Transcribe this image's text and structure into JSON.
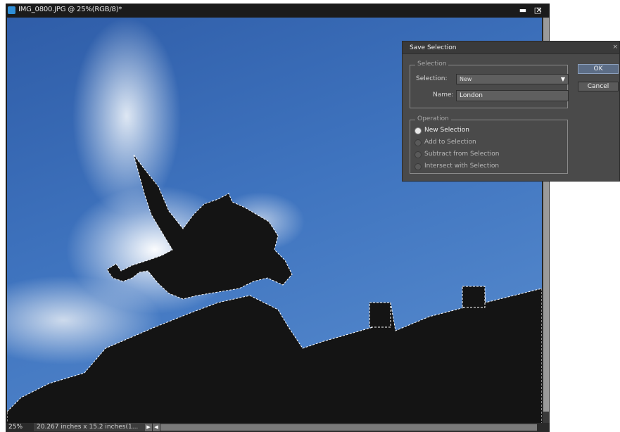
{
  "window": {
    "title": "IMG_0800.JPG @ 25%(RGB/8)*",
    "minimize_glyph": "▬",
    "maximize_glyph": "□",
    "close_glyph": "✕"
  },
  "status": {
    "zoom": "25%",
    "doc_size": "20.267 inches x 15.2 inches(1...",
    "scroll_right_glyph": "▶",
    "scroll_left_glyph": "◀"
  },
  "dialog": {
    "title": "Save Selection",
    "close_glyph": "×",
    "selection_group": "Selection",
    "selection_label": "Selection:",
    "selection_value": "New",
    "selection_arrow": "▼",
    "name_label": "Name:",
    "name_value": "London",
    "operation_group": "Operation",
    "operations": [
      {
        "label": "New Selection",
        "selected": true
      },
      {
        "label": "Add to Selection",
        "selected": false
      },
      {
        "label": "Subtract from Selection",
        "selected": false
      },
      {
        "label": "Intersect with Selection",
        "selected": false
      }
    ],
    "ok_label": "OK",
    "cancel_label": "Cancel"
  },
  "colors": {
    "sky": "#3f74bf",
    "silhouette": "#141414",
    "ok_button": "#5c6d86"
  }
}
